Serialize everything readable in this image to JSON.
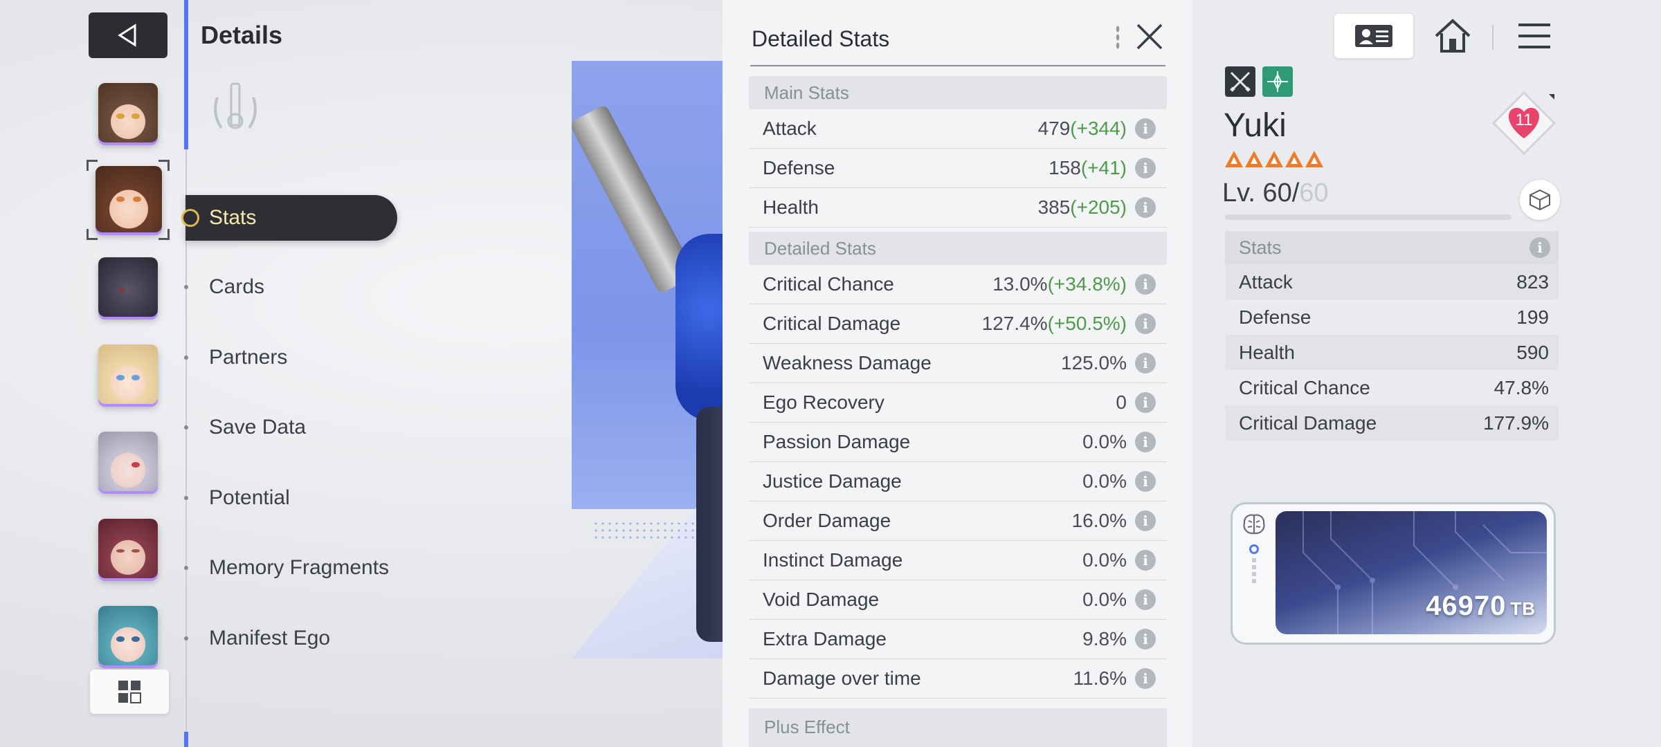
{
  "header": {
    "title": "Details"
  },
  "nav": {
    "active": "Stats",
    "items": [
      "Cards",
      "Partners",
      "Save Data",
      "Potential",
      "Memory Fragments",
      "Manifest Ego"
    ]
  },
  "detailed_stats": {
    "title": "Detailed Stats",
    "main_section": "Main Stats",
    "main": [
      {
        "name": "Attack",
        "value": "479",
        "bonus": "(+344)"
      },
      {
        "name": "Defense",
        "value": "158",
        "bonus": "(+41)"
      },
      {
        "name": "Health",
        "value": "385",
        "bonus": "(+205)"
      }
    ],
    "detail_section": "Detailed Stats",
    "detail": [
      {
        "name": "Critical Chance",
        "value": "13.0%",
        "bonus": "(+34.8%)"
      },
      {
        "name": "Critical Damage",
        "value": "127.4%",
        "bonus": "(+50.5%)"
      },
      {
        "name": "Weakness Damage",
        "value": "125.0%",
        "bonus": ""
      },
      {
        "name": "Ego Recovery",
        "value": "0",
        "bonus": ""
      },
      {
        "name": "Passion Damage",
        "value": "0.0%",
        "bonus": ""
      },
      {
        "name": "Justice Damage",
        "value": "0.0%",
        "bonus": ""
      },
      {
        "name": "Order Damage",
        "value": "16.0%",
        "bonus": ""
      },
      {
        "name": "Instinct Damage",
        "value": "0.0%",
        "bonus": ""
      },
      {
        "name": "Void Damage",
        "value": "0.0%",
        "bonus": ""
      },
      {
        "name": "Extra Damage",
        "value": "9.8%",
        "bonus": ""
      },
      {
        "name": "Damage over time",
        "value": "11.6%",
        "bonus": ""
      }
    ],
    "next_section_partial": "Plus Effect"
  },
  "character": {
    "name": "Yuki",
    "stars": 5,
    "level_prefix": "Lv. 60/",
    "level_max": "60",
    "affection": "11",
    "stats_title": "Stats",
    "stats": [
      {
        "name": "Attack",
        "value": "823"
      },
      {
        "name": "Defense",
        "value": "199"
      },
      {
        "name": "Health",
        "value": "590"
      },
      {
        "name": "Critical Chance",
        "value": "47.8%"
      },
      {
        "name": "Critical Damage",
        "value": "177.9%"
      }
    ],
    "memory_value": "46970",
    "memory_unit": "TB"
  },
  "colors": {
    "accent_blue": "#5577ee",
    "bonus_green": "#4f9a4a",
    "star_orange": "#ec7c2c",
    "heart_pink": "#e8436a",
    "nav_active_text": "#f6e8b0"
  },
  "icons": {
    "back": "back-triangle-icon",
    "grid": "grid-icon",
    "close": "close-icon",
    "profile": "id-card-icon",
    "home": "home-icon",
    "menu": "hamburger-menu-icon",
    "class": "crossed-swords-icon",
    "attribute": "order-attribute-icon",
    "affection": "heart-icon",
    "cube": "cube-icon",
    "memory": "brain-icon"
  }
}
